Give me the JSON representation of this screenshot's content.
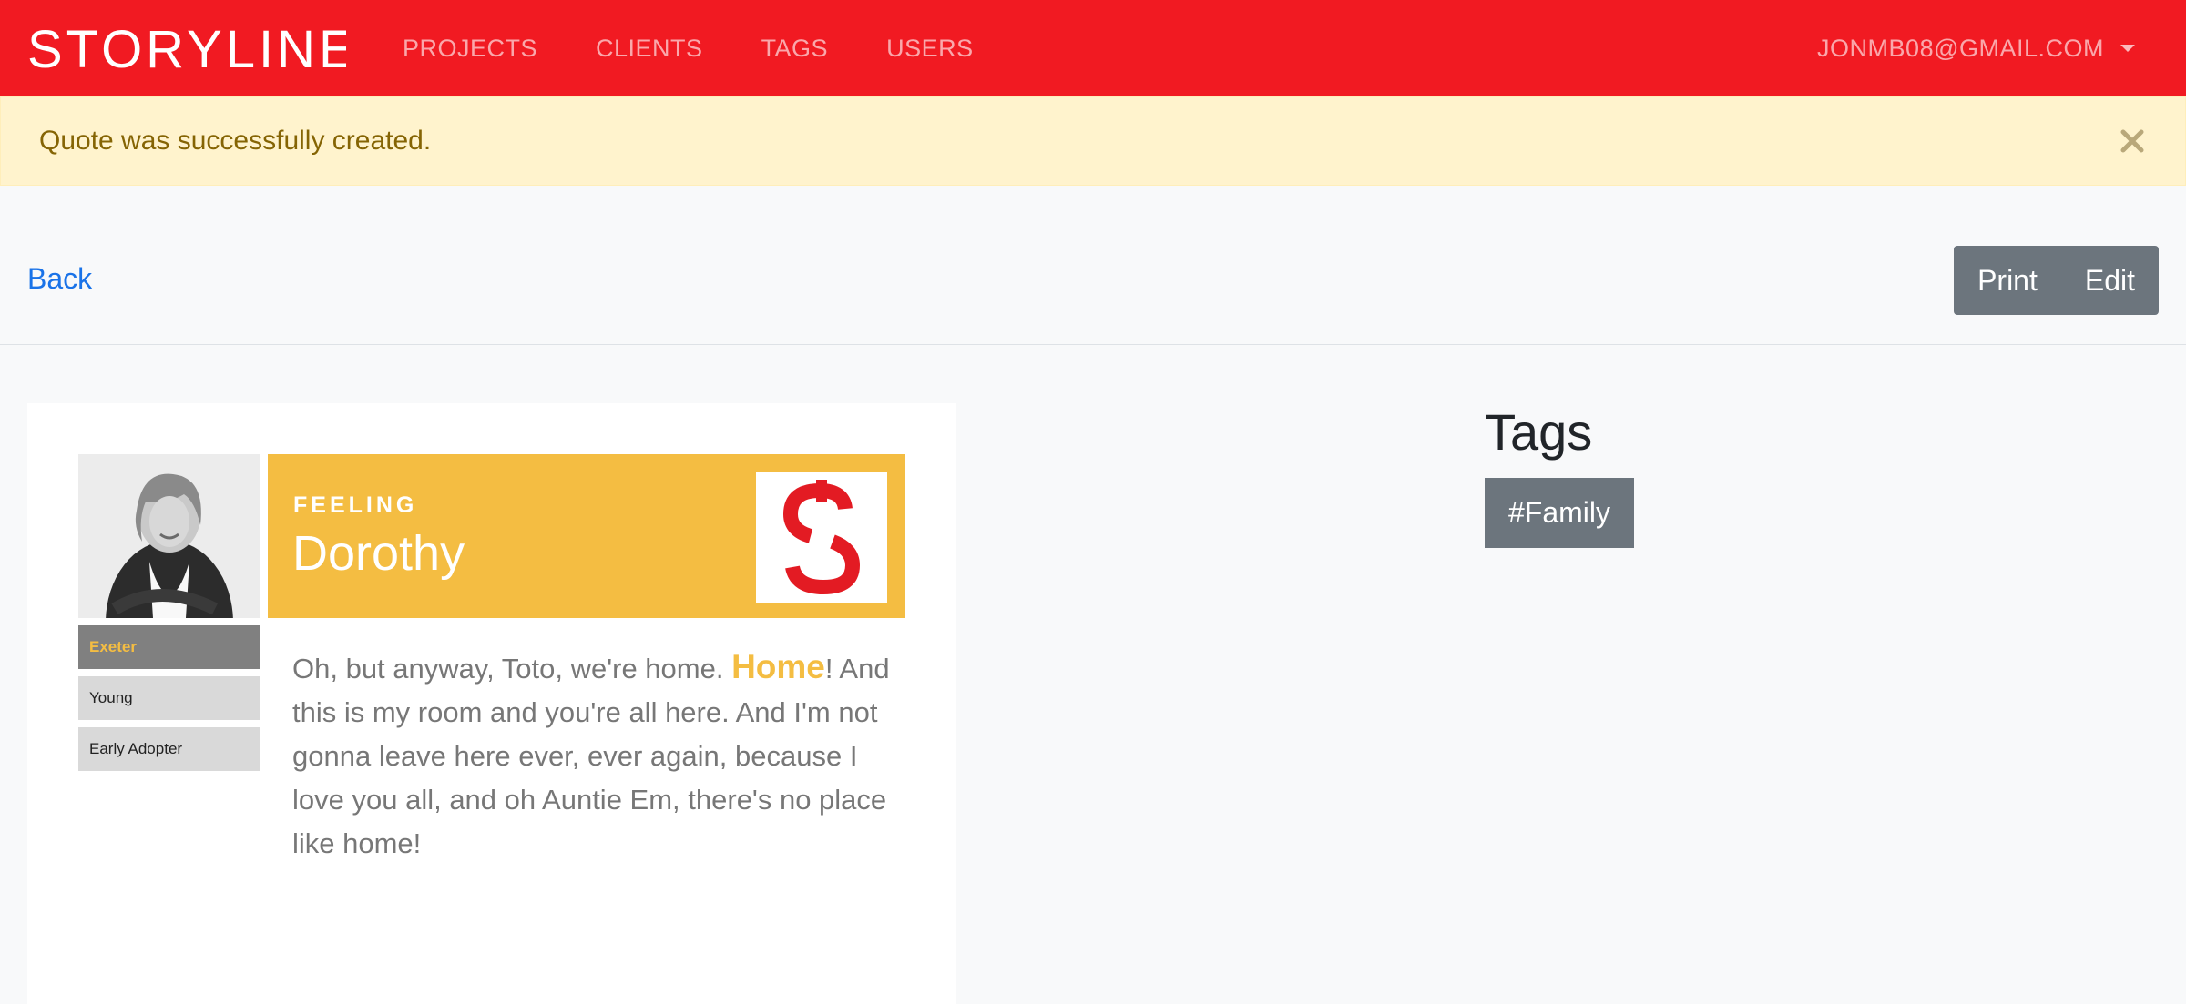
{
  "brand": {
    "name": "STORYLINE"
  },
  "nav": {
    "links": [
      "PROJECTS",
      "CLIENTS",
      "TAGS",
      "USERS"
    ],
    "user": "JONMB08@GMAIL.COM"
  },
  "alert": {
    "message": "Quote was successfully created."
  },
  "toolbar": {
    "back": "Back",
    "print": "Print",
    "edit": "Edit"
  },
  "quote": {
    "kicker": "FEELING",
    "person": "Dorothy",
    "attributes": [
      "Exeter",
      "Young",
      "Early Adopter"
    ],
    "text_before": "Oh, but anyway, Toto, we're home. ",
    "highlight": "Home",
    "text_after": "! And this is my room and you're all here. And I'm not gonna leave here ever, ever again, because I love you all, and oh Auntie Em, there's no place like home!"
  },
  "tags": {
    "title": "Tags",
    "items": [
      "#Family"
    ]
  },
  "colors": {
    "brand_red": "#f11a22",
    "accent_yellow": "#f4bd42",
    "button_gray": "#6c757d"
  }
}
